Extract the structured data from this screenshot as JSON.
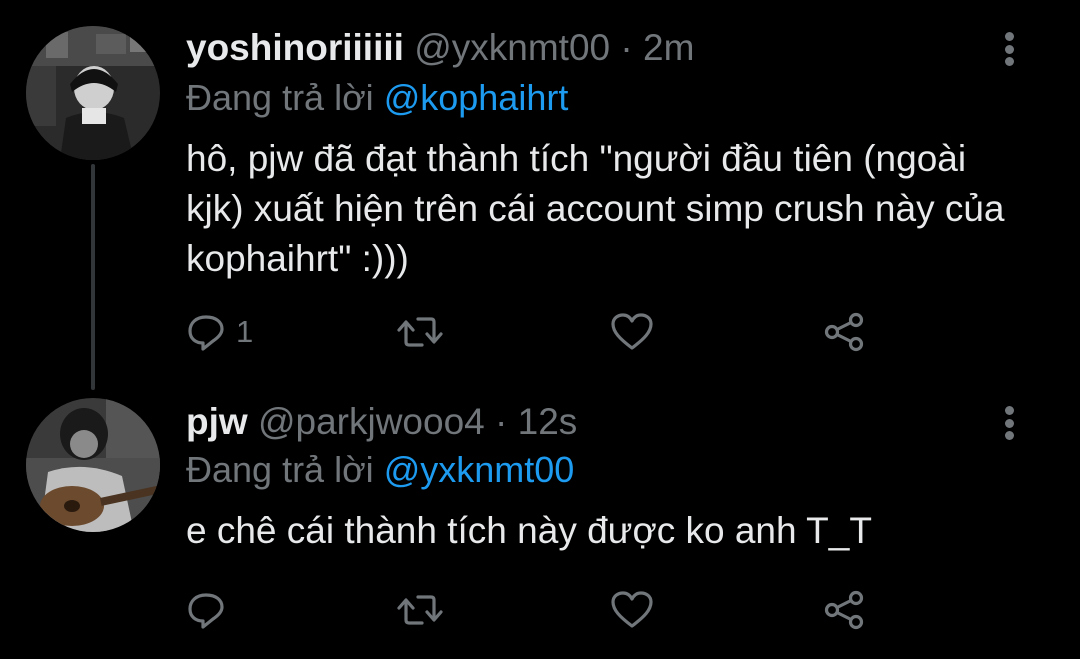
{
  "colors": {
    "background": "#000000",
    "primary_text": "#e7e9ea",
    "secondary_text": "#71767b",
    "link": "#1d9bf0",
    "thread_line": "#333639"
  },
  "tweets": [
    {
      "display_name": "yoshinoriiiiii",
      "handle": "@yxknmt00",
      "time": " · 2m",
      "replying_label": "Đang trả lời ",
      "replying_to": "@kophaihrt",
      "text": "hô, pjw đã đạt thành tích \"người đầu tiên (ngoài kjk) xuất hiện trên cái account simp crush này của kophaihrt\" :)))",
      "reply_count": "1",
      "icons": [
        "avatar",
        "more-vertical-icon",
        "reply-icon",
        "retweet-icon",
        "like-icon",
        "share-icon"
      ]
    },
    {
      "display_name": "pjw",
      "handle": "@parkjwooo4",
      "time": " · 12s",
      "replying_label": "Đang trả lời ",
      "replying_to": "@yxknmt00",
      "text": "e chê cái thành tích này được ko anh T_T",
      "reply_count": "",
      "icons": [
        "avatar",
        "more-vertical-icon",
        "reply-icon",
        "retweet-icon",
        "like-icon",
        "share-icon"
      ]
    }
  ]
}
